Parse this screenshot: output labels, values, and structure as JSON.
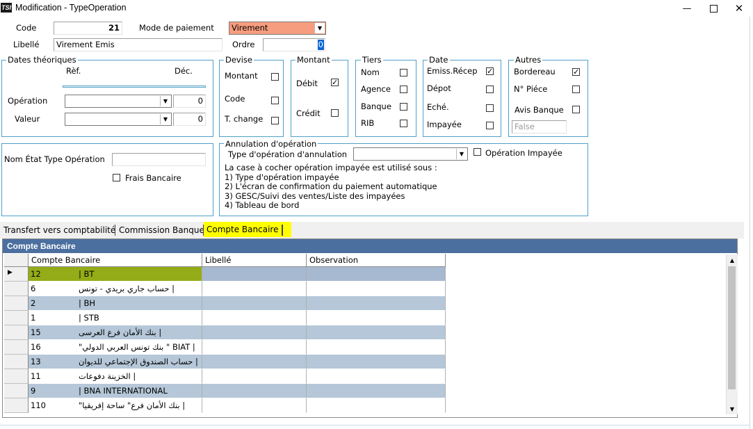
{
  "window": {
    "app_icon": "TSI",
    "title": "Modification - TypeOperation",
    "minimize_icon": "minimize-icon",
    "maximize_icon": "maximize-icon",
    "close_icon": "close-icon"
  },
  "form": {
    "code_label": "Code",
    "code_value": "21",
    "mode_label": "Mode de paiement",
    "mode_value": "Virement",
    "mode_color": "#f79d7f",
    "libelle_label": "Libellé",
    "libelle_value": "Virement Emis",
    "ordre_label": "Ordre",
    "ordre_value": "0"
  },
  "dates": {
    "title": "Dates théoriques",
    "ref_label": "Rèf.",
    "dec_label": "Déc.",
    "operation_label": "Opération",
    "operation_value": "0",
    "valeur_label": "Valeur",
    "valeur_value": "0"
  },
  "devise": {
    "title": "Devise",
    "items": [
      {
        "label": "Montant",
        "checked": false
      },
      {
        "label": "Code",
        "checked": false
      },
      {
        "label": "T. change",
        "checked": false
      }
    ]
  },
  "montant": {
    "title": "Montant",
    "items": [
      {
        "label": "Débit",
        "checked": true
      },
      {
        "label": "Crédit",
        "checked": false
      }
    ]
  },
  "tiers": {
    "title": "Tiers",
    "items": [
      {
        "label": "Nom",
        "checked": false
      },
      {
        "label": "Agence",
        "checked": false
      },
      {
        "label": "Banque",
        "checked": false
      },
      {
        "label": "RIB",
        "checked": false
      }
    ]
  },
  "date_group": {
    "title": "Date",
    "items": [
      {
        "label": "Emiss.Récep",
        "checked": true
      },
      {
        "label": "Dépot",
        "checked": false
      },
      {
        "label": "Eché.",
        "checked": false
      },
      {
        "label": "Impayée",
        "checked": false
      }
    ]
  },
  "autres": {
    "title": "Autres",
    "items": [
      {
        "label": "Bordereau",
        "checked": true
      },
      {
        "label": "N° Piéce",
        "checked": false
      },
      {
        "label": "Avis Banque",
        "checked": false
      }
    ],
    "false_field": "False"
  },
  "etat": {
    "nom_label": "Nom État Type Opération",
    "nom_value": "",
    "frais_label": "Frais Bancaire",
    "frais_checked": false
  },
  "annulation": {
    "title": "Annulation d'opération",
    "type_label": "Type d'opération d'annulation",
    "type_value": "",
    "impayee_label": "Opération Impayée",
    "impayee_checked": false,
    "info_lines": [
      "La case à cocher opération impayée est utilisé sous :",
      "1) Type d'opération impayée",
      "2) L'écran de confirmation du paiement automatique",
      "3) GESC/Suivi des ventes/Liste des impayées",
      "4) Tableau de bord"
    ]
  },
  "tabs": [
    {
      "label": "Transfert vers comptabilité",
      "active": false
    },
    {
      "label": "Commission Banque",
      "active": false
    },
    {
      "label": "Compte Bancaire",
      "active": true
    }
  ],
  "grid": {
    "title": "Compte Bancaire",
    "columns": [
      "Compte Bancaire",
      "Libellé",
      "Observation"
    ],
    "rows": [
      {
        "code": "12",
        "bank": "| BT",
        "libelle": "",
        "observation": ""
      },
      {
        "code": "6",
        "bank": "حساب جاري بريدي - تونس |",
        "libelle": "",
        "observation": ""
      },
      {
        "code": "2",
        "bank": "| BH",
        "libelle": "",
        "observation": ""
      },
      {
        "code": "1",
        "bank": "| STB",
        "libelle": "",
        "observation": ""
      },
      {
        "code": "15",
        "bank": "بنك الأمان فرع العرسى |",
        "libelle": "",
        "observation": ""
      },
      {
        "code": "16",
        "bank": "\"بنك تونس العربي الدولي \" BIAT |",
        "libelle": "",
        "observation": ""
      },
      {
        "code": "13",
        "bank": "حساب الصندوق الإجتماعي للديوان |",
        "libelle": "",
        "observation": ""
      },
      {
        "code": "11",
        "bank": "الخزينة دفوعات |",
        "libelle": "",
        "observation": ""
      },
      {
        "code": "9",
        "bank": "| BNA INTERNATIONAL",
        "libelle": "",
        "observation": ""
      },
      {
        "code": "110",
        "bank": "\"بنك الأمان فرع\" ساحة إفريقيا |",
        "libelle": "",
        "observation": ""
      }
    ],
    "selected_row": 0
  },
  "colors": {
    "group_border": "#4da0c8",
    "grid_header": "#4b6f9f",
    "row_alt": "#b5c7d8",
    "highlight_yellow": "#ffff00",
    "selected_cell": "#94ac17",
    "selected_row": "#a6b9d0"
  }
}
